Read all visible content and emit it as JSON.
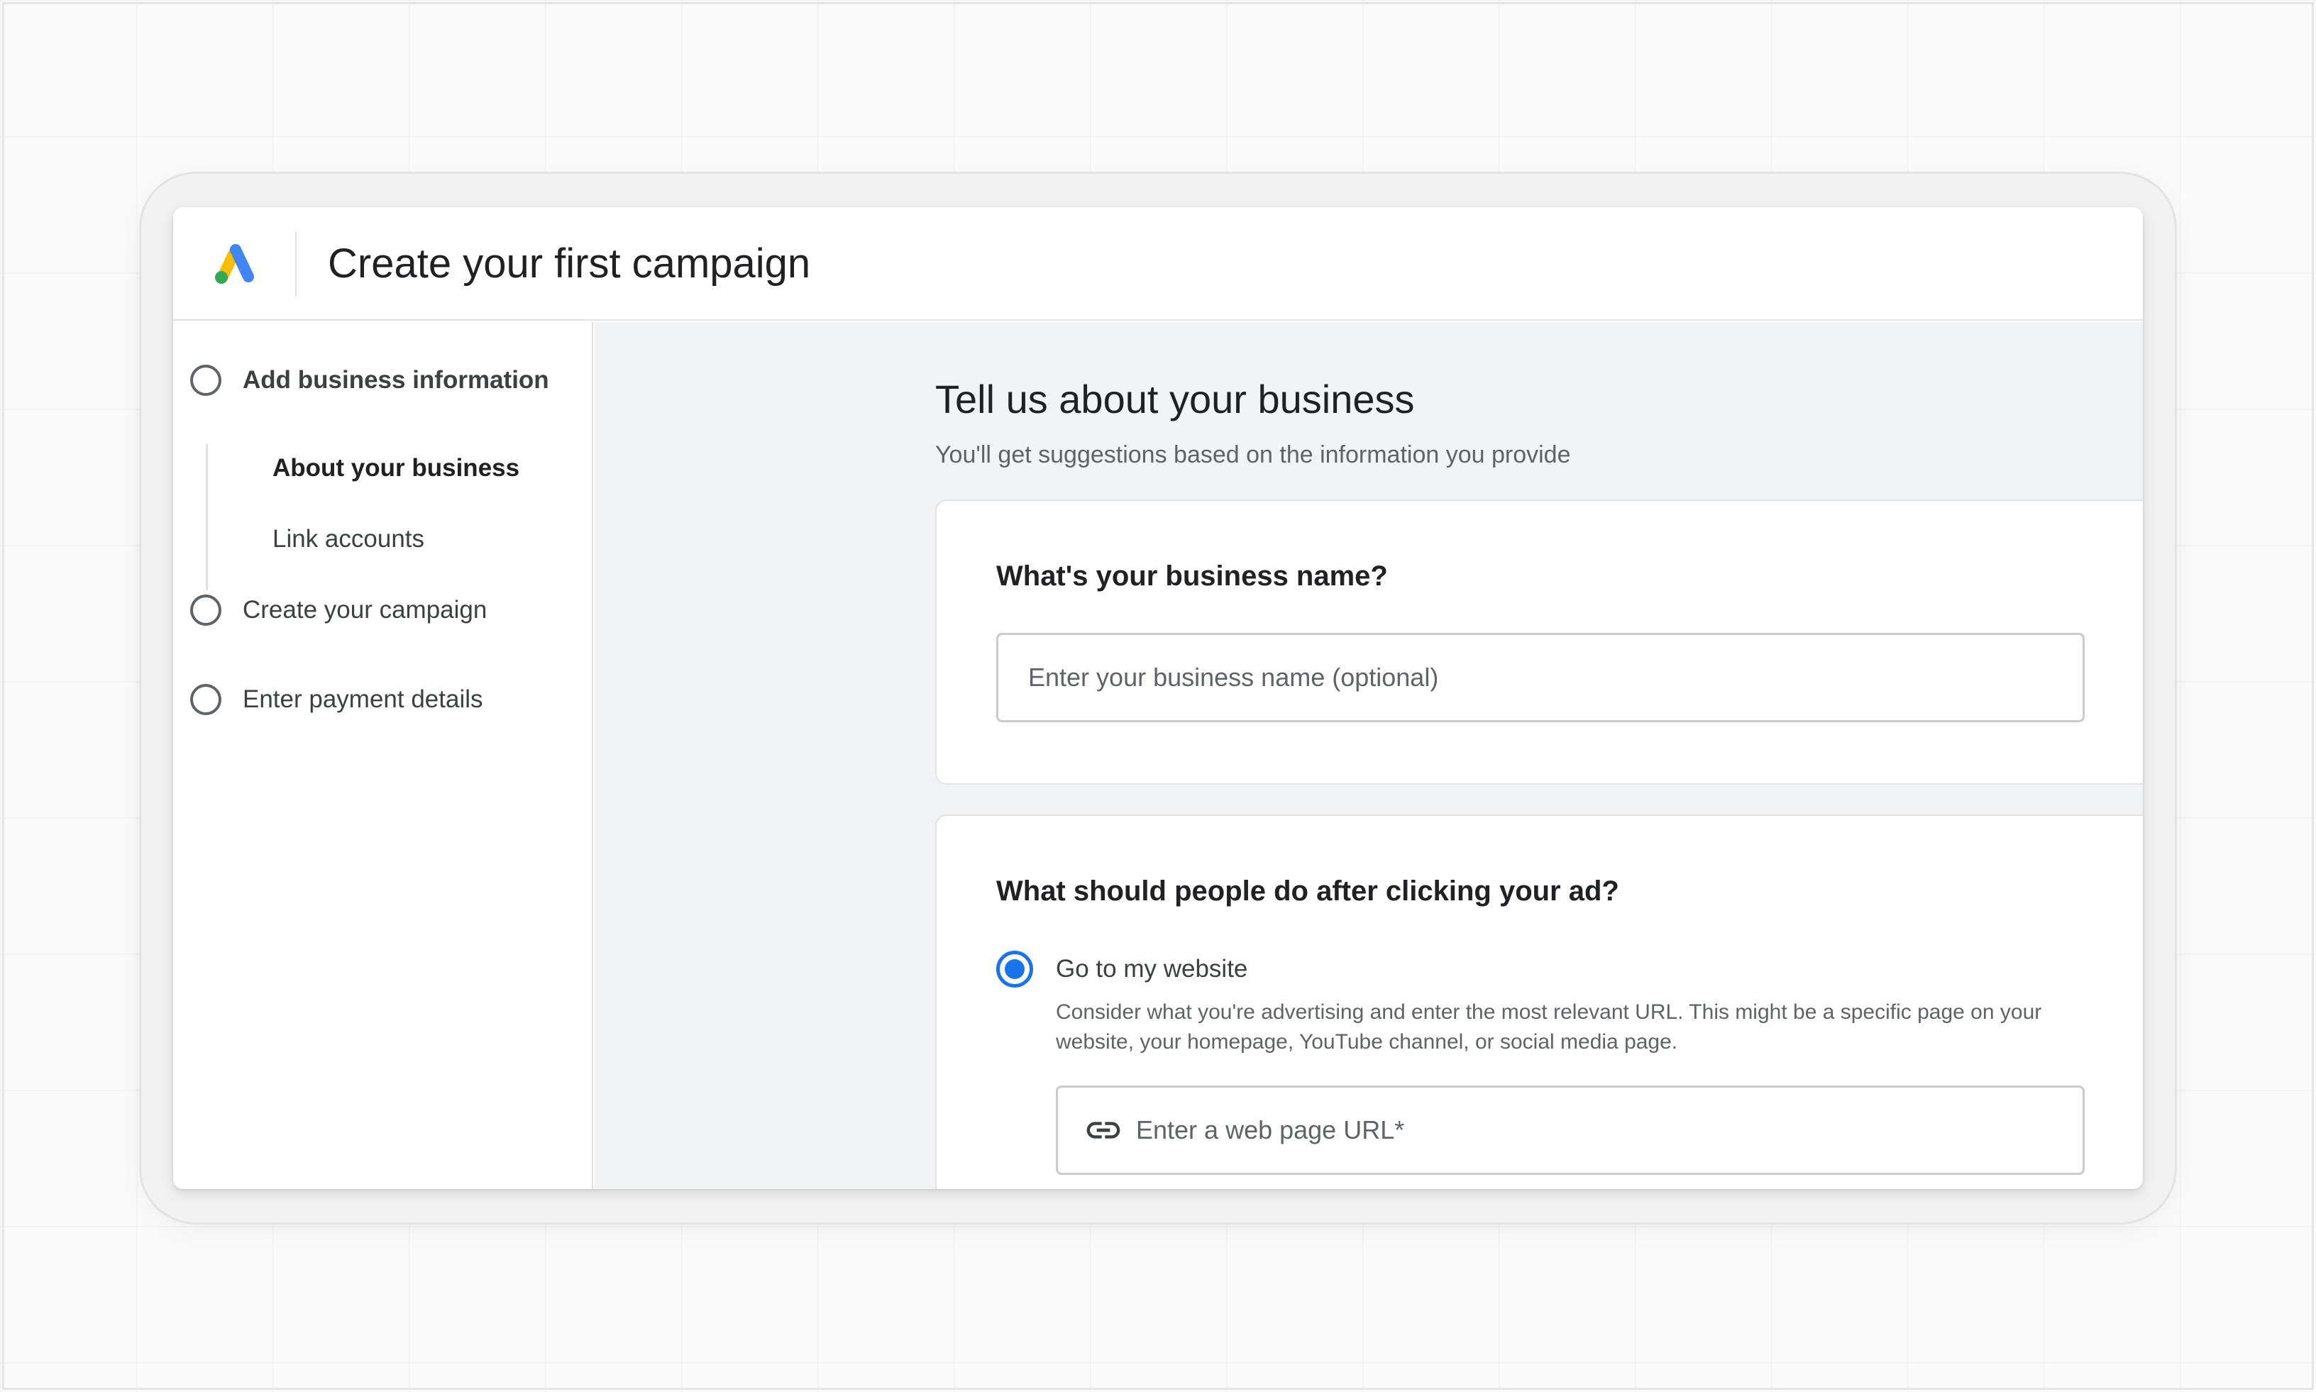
{
  "header": {
    "title": "Create your first campaign",
    "logo_icon": "google-ads-logo-icon"
  },
  "sidebar": {
    "steps": [
      {
        "label": "Add business information",
        "active": true
      },
      {
        "label": "Create your campaign",
        "active": false
      },
      {
        "label": "Enter payment details",
        "active": false
      }
    ],
    "substeps": [
      {
        "label": "About your business",
        "active": true
      },
      {
        "label": "Link accounts",
        "active": false
      }
    ]
  },
  "main": {
    "title": "Tell us about your business",
    "subtitle": "You'll get suggestions based on the information you provide",
    "business_name": {
      "question": "What's your business name?",
      "placeholder": "Enter your business name (optional)",
      "value": ""
    },
    "after_click": {
      "question": "What should people do after clicking your ad?",
      "options": [
        {
          "label": "Go to my website",
          "selected": true,
          "description": "Consider what you're advertising and enter the most relevant URL. This might be a specific page on your website, your homepage, YouTube channel, or social media page."
        }
      ],
      "url_placeholder": "Enter a web page URL*",
      "url_value": "",
      "url_icon": "link-icon"
    }
  },
  "colors": {
    "accent": "#1a73e8",
    "logo_blue": "#4285f4",
    "logo_yellow": "#fbbc04",
    "logo_green": "#34a853"
  }
}
